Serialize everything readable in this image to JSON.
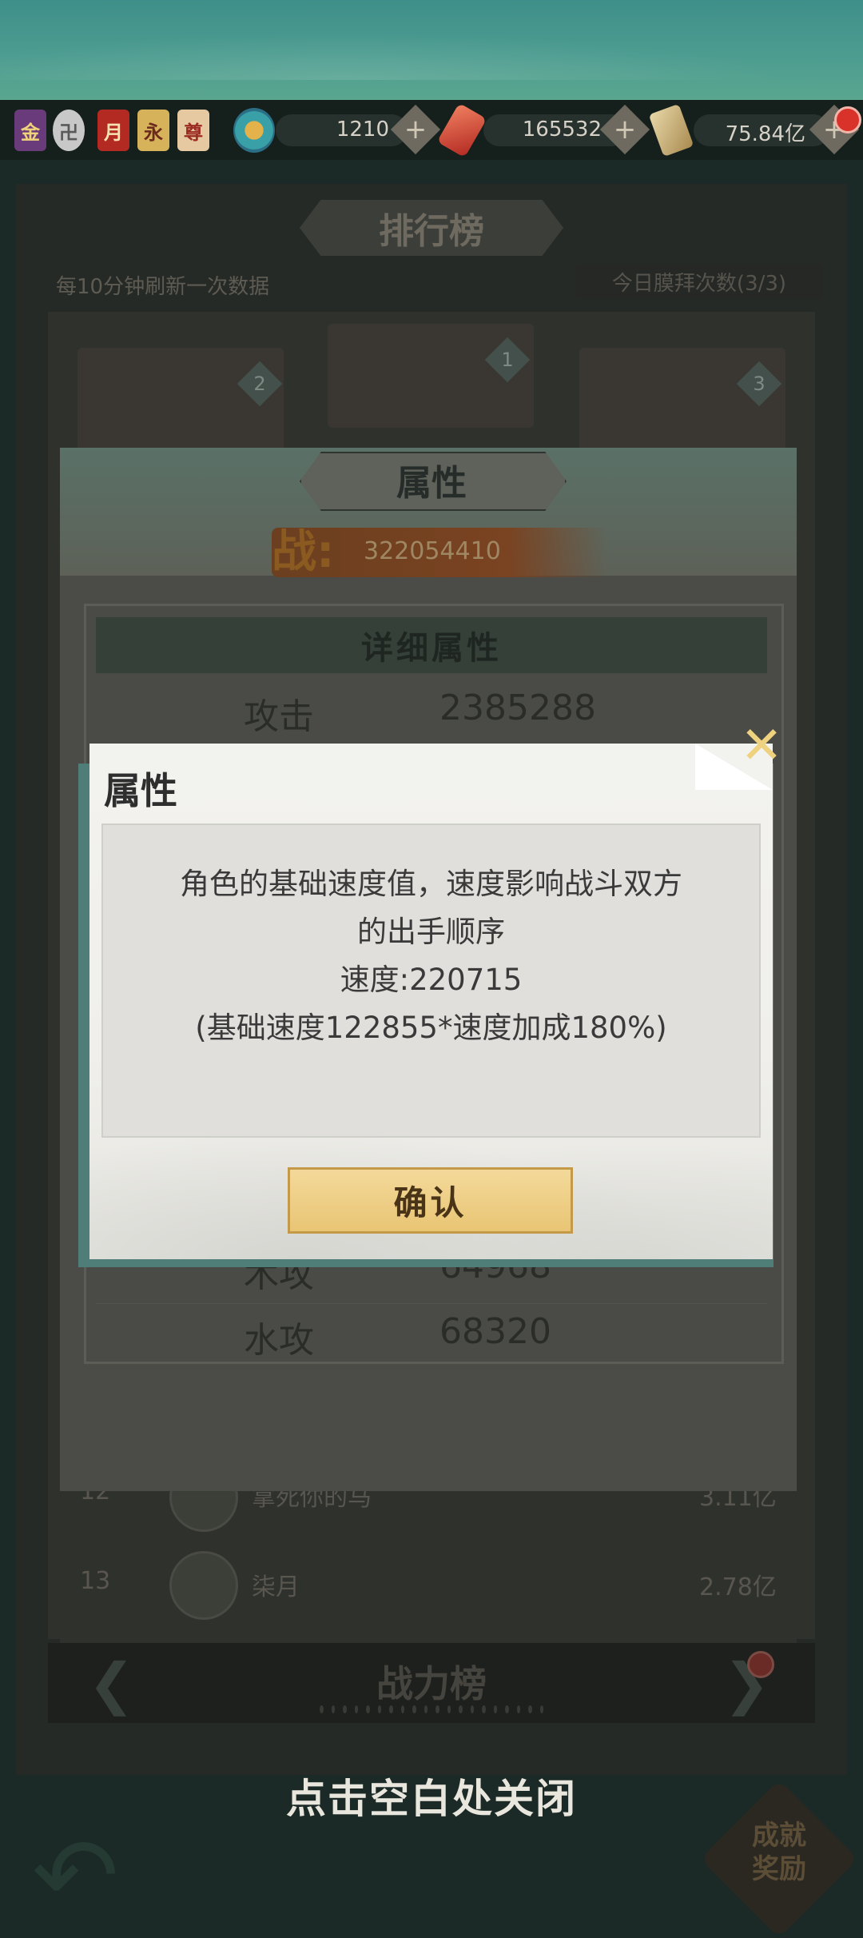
{
  "top_badges": [
    "金",
    "卍",
    "月",
    "永",
    "尊"
  ],
  "resources": [
    {
      "icon": "jade-swirl-icon",
      "value": "1210"
    },
    {
      "icon": "red-gem-icon",
      "value": "165532"
    },
    {
      "icon": "scroll-icon",
      "value": "75.84亿"
    }
  ],
  "background": {
    "title": "排行榜",
    "refresh_note": "每10分钟刷新一次数据",
    "today_count": "今日膜拜次数(3/3)",
    "top_ranks": [
      "2",
      "1",
      "3"
    ],
    "rows": [
      {
        "rank": "12",
        "name": "拿死你的马",
        "value": "3.11亿"
      },
      {
        "rank": "13",
        "name": "柒月",
        "value": "2.78亿"
      }
    ],
    "footer_title": "战力榜",
    "close_hint": "点击空白处关闭",
    "achievement_label": "成就奖励"
  },
  "attribute_panel": {
    "title": "属性",
    "power_label": "战:",
    "power_value": "322054410",
    "detail_title": "详细属性",
    "stats": [
      {
        "name": "攻击",
        "value": "2385288"
      },
      {
        "name": "木攻",
        "value": "64968"
      },
      {
        "name": "水攻",
        "value": "68320"
      }
    ]
  },
  "dialog": {
    "title": "属性",
    "line1": "角色的基础速度值，速度影响战斗双方",
    "line2": "的出手顺序",
    "line3": "速度:220715",
    "line4": "(基础速度122855*速度加成180%)",
    "confirm_label": "确认"
  }
}
